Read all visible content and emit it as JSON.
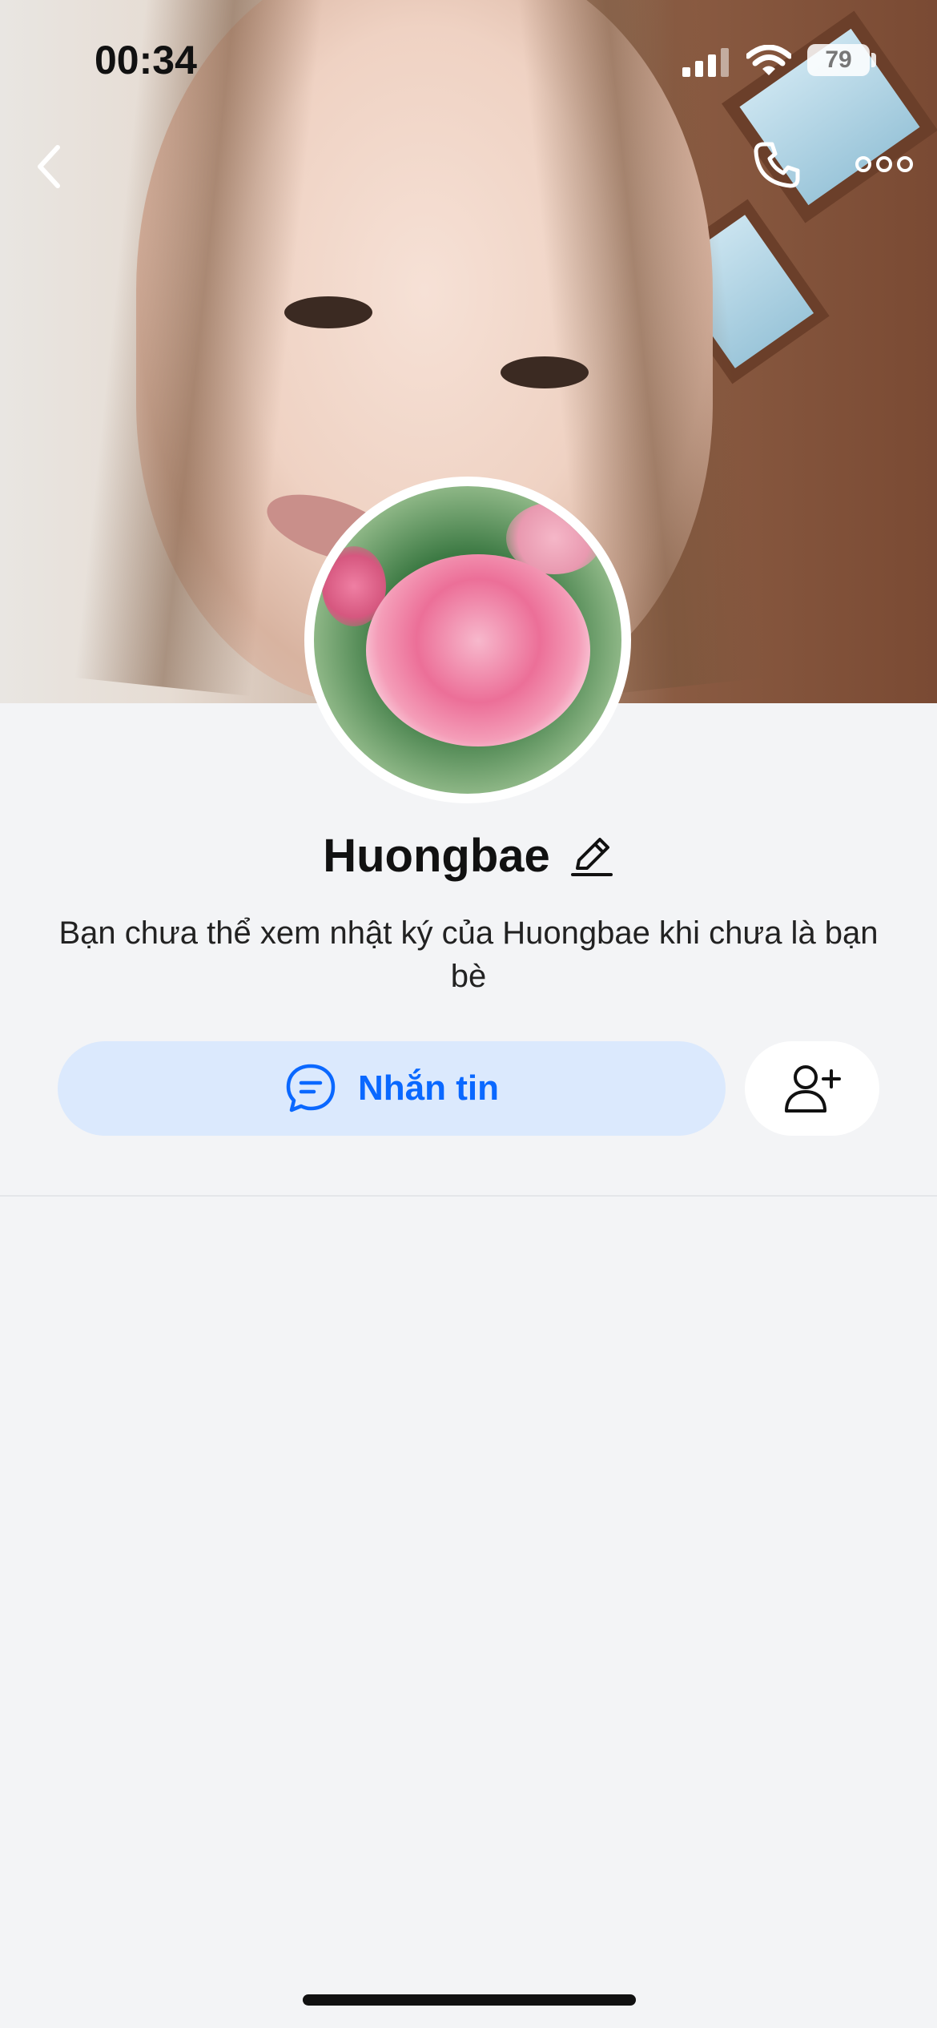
{
  "status_bar": {
    "time": "00:34",
    "battery": "79"
  },
  "header": {
    "icons": [
      "back-icon",
      "call-icon",
      "more-icon"
    ]
  },
  "profile": {
    "name": "Huongbae",
    "note": "Bạn chưa thể xem nhật ký của Huongbae khi chưa là bạn bè"
  },
  "actions": {
    "message_label": "Nhắn tin",
    "message_icon": "chat-bubble-icon",
    "add_friend_icon": "add-friend-icon"
  },
  "colors": {
    "accent": "#0a68ff",
    "message_button_bg": "#dbe9fd",
    "page_bg": "#f3f4f6"
  }
}
